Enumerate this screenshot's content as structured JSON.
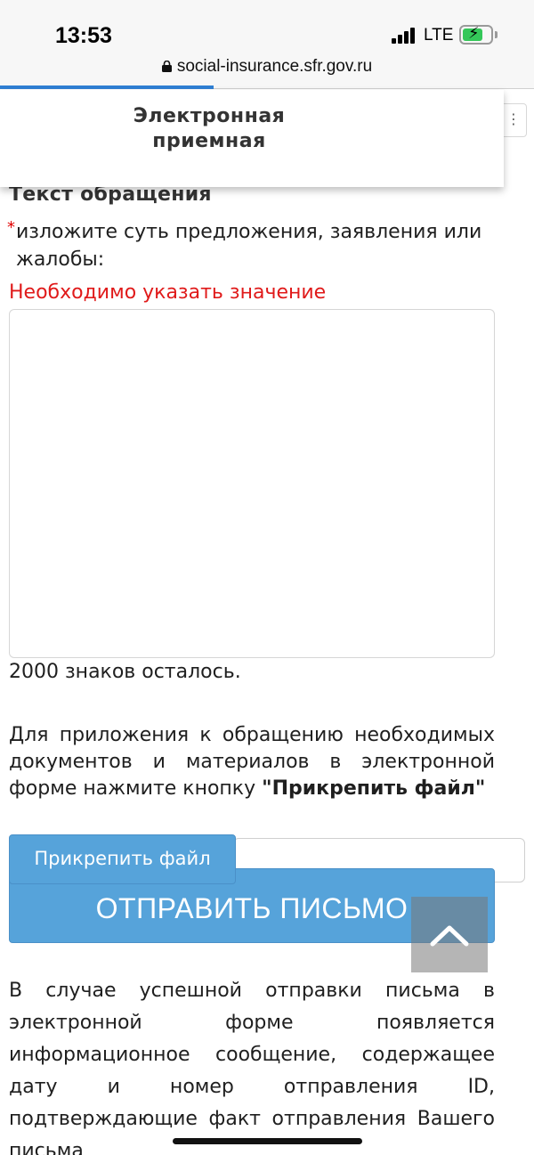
{
  "status_bar": {
    "time": "13:53",
    "network": "LTE",
    "url": "social-insurance.sfr.gov.ru",
    "page_load_progress": 0.4
  },
  "header": {
    "title": "Электронная приемная",
    "menu_icon": "more-icon"
  },
  "form": {
    "section_title": "Текст обращения",
    "required_marker": "*",
    "field_label": "изложите суть предложения, заявления или жалобы:",
    "error_message": "Необходимо указать значение",
    "textarea_value": "",
    "chars_left": "2000 знаков осталось.",
    "attach_info_text": "Для приложения к обращению необходимых документов и материалов в электронной форме нажмите кнопку ",
    "attach_info_bold": "\"Прикрепить файл\"",
    "attach_button_label": "Прикрепить файл",
    "file_field_value": "",
    "send_button_label": "ОТПРАВИТЬ ПИСЬМО",
    "result_info": "В случае успешной отправки письма в электронной форме появляется информационное сообщение, содержащее дату и номер отправления ID, подтверждающие факт отправления Вашего письма"
  },
  "colors": {
    "error": "#e01a1a",
    "button": "#56a3da",
    "progress": "#2f7fd4"
  }
}
